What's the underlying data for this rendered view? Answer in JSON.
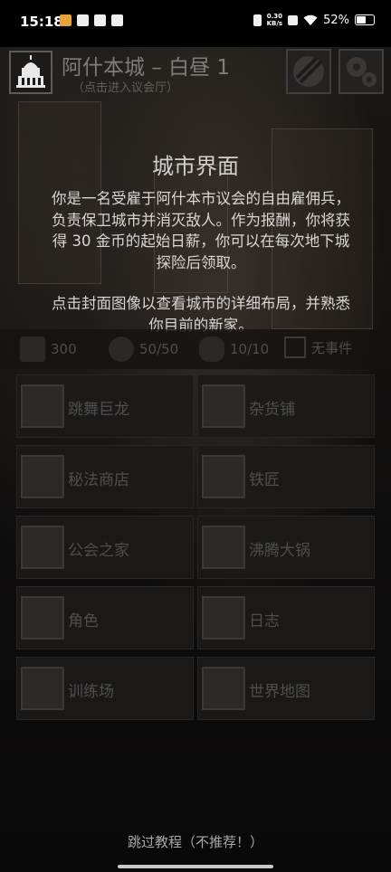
{
  "status_bar": {
    "time": "15:18",
    "net_speed_value": "0.30",
    "net_speed_unit": "KB/s",
    "battery": "52%"
  },
  "header": {
    "title": "阿什本城 – 白昼 1",
    "subtitle": "（点击进入议会厅）"
  },
  "tutorial": {
    "title": "城市界面",
    "paragraph1": "你是一名受雇于阿什本市议会的自由雇佣兵，负责保卫城市并消灭敌人。作为报酬，你将获得 30 金币的起始日薪，你可以在每次地下城探险后领取。",
    "paragraph2": "点击封面图像以查看城市的详细布局，并熟悉你目前的新家。"
  },
  "stats": {
    "gold": "300",
    "food": "50/50",
    "sanity": "10/10",
    "event": "无事件"
  },
  "buildings": [
    {
      "label": "跳舞巨龙",
      "icon": "tankard-icon"
    },
    {
      "label": "杂货铺",
      "icon": "scales-icon"
    },
    {
      "label": "秘法商店",
      "icon": "spellbook-icon"
    },
    {
      "label": "铁匠",
      "icon": "anvil-icon"
    },
    {
      "label": "公会之家",
      "icon": "guild-shield-icon"
    },
    {
      "label": "沸腾大锅",
      "icon": "cauldron-icon"
    },
    {
      "label": "角色",
      "icon": "knight-helmet-icon"
    },
    {
      "label": "日志",
      "icon": "quill-scroll-icon"
    },
    {
      "label": "训练场",
      "icon": "crossed-swords-icon"
    },
    {
      "label": "世界地图",
      "icon": "map-icon"
    }
  ],
  "skip_tutorial": "跳过教程（不推荐！）"
}
